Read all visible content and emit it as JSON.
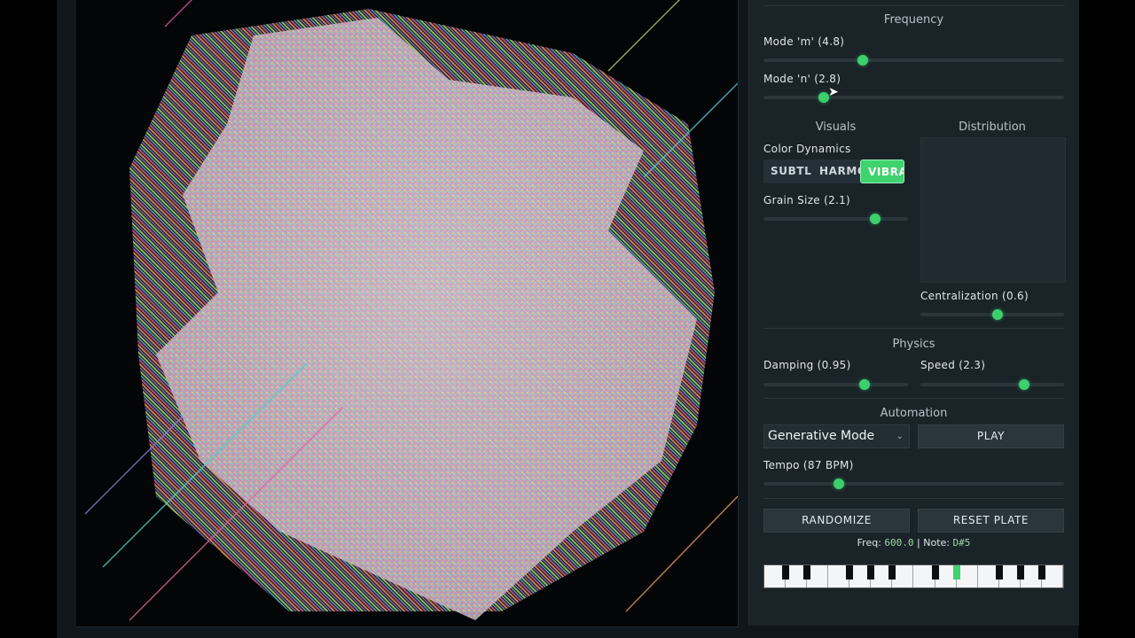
{
  "panel": {
    "frequency_title": "Frequency",
    "mode_m_label": "Mode 'm' (4.8)",
    "mode_m_value": 0.33,
    "mode_n_label": "Mode 'n' (2.8)",
    "mode_n_value": 0.2,
    "visuals_title": "Visuals",
    "distribution_title": "Distribution",
    "color_dynamics_label": "Color Dynamics",
    "color_options": [
      "SUBTLE",
      "HARMONIC",
      "VIBRANT"
    ],
    "color_selected": "VIBRANT",
    "grain_label": "Grain Size (2.1)",
    "grain_value": 0.77,
    "centralization_label": "Centralization (0.6)",
    "centralization_value": 0.54,
    "physics_title": "Physics",
    "damping_label": "Damping (0.95)",
    "damping_value": 0.7,
    "speed_label": "Speed (2.3)",
    "speed_value": 0.72,
    "automation_title": "Automation",
    "mode_select_value": "Generative Mode",
    "play_label": "PLAY",
    "tempo_label": "Tempo (87 BPM)",
    "tempo_value": 0.25,
    "randomize_label": "RANDOMIZE",
    "reset_label": "RESET PLATE",
    "freq_prefix": "Freq:",
    "freq_value": "600.0",
    "note_prefix": "| Note:",
    "note_value": "D#5"
  },
  "accent_color": "#3ccf6e"
}
